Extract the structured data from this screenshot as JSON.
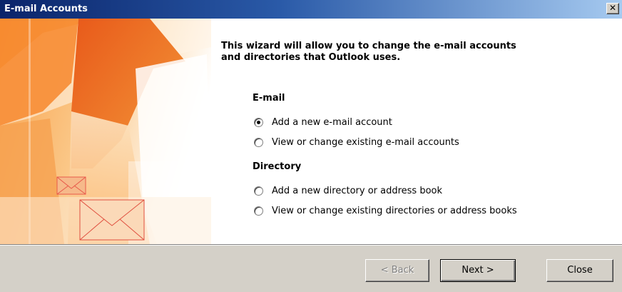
{
  "window": {
    "title": "E-mail Accounts",
    "close_glyph": "✕"
  },
  "wizard": {
    "heading": "This wizard will allow you to change the e-mail accounts and directories that Outlook uses.",
    "email_section": "E-mail",
    "email_options": [
      {
        "label": "Add a new e-mail account",
        "checked": true
      },
      {
        "label": "View or change existing e-mail accounts",
        "checked": false
      }
    ],
    "directory_section": "Directory",
    "directory_options": [
      {
        "label": "Add a new directory or address book",
        "checked": false
      },
      {
        "label": "View or change existing directories or address books",
        "checked": false
      }
    ]
  },
  "buttons": {
    "back": "< Back",
    "next": "Next >",
    "close": "Close"
  },
  "colors": {
    "titlebar_start": "#0a246a",
    "titlebar_end": "#a6caf0",
    "banner_orange": "#f07a1e",
    "dialog_gray": "#d4d0c8"
  }
}
